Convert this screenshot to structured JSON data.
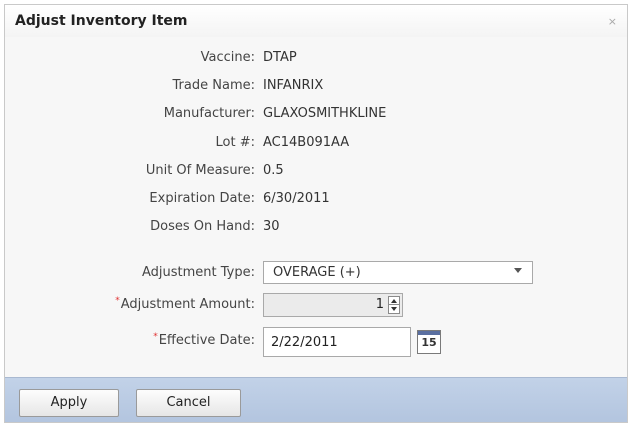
{
  "dialog": {
    "title": "Adjust Inventory Item",
    "close_glyph": "×"
  },
  "details": [
    {
      "label": "Vaccine:",
      "value": "DTAP"
    },
    {
      "label": "Trade Name:",
      "value": "INFANRIX"
    },
    {
      "label": "Manufacturer:",
      "value": "GLAXOSMITHKLINE"
    },
    {
      "label": "Lot #:",
      "value": "AC14B091AA"
    },
    {
      "label": "Unit Of Measure:",
      "value": "0.5"
    },
    {
      "label": "Expiration Date:",
      "value": "6/30/2011"
    },
    {
      "label": "Doses On Hand:",
      "value": "30"
    }
  ],
  "form": {
    "required_mark": "*",
    "adjustment_type": {
      "label": "Adjustment Type:",
      "value": "OVERAGE (+)"
    },
    "adjustment_amount": {
      "label": "Adjustment Amount:",
      "value": "1"
    },
    "effective_date": {
      "label": "Effective Date:",
      "value": "2/22/2011",
      "calendar_day": "15"
    }
  },
  "footer": {
    "apply_label": "Apply",
    "cancel_label": "Cancel"
  },
  "colors": {
    "footer_bg": "#b8c9e1",
    "required": "#e03030",
    "calendar_bar": "#5a6fa0"
  }
}
